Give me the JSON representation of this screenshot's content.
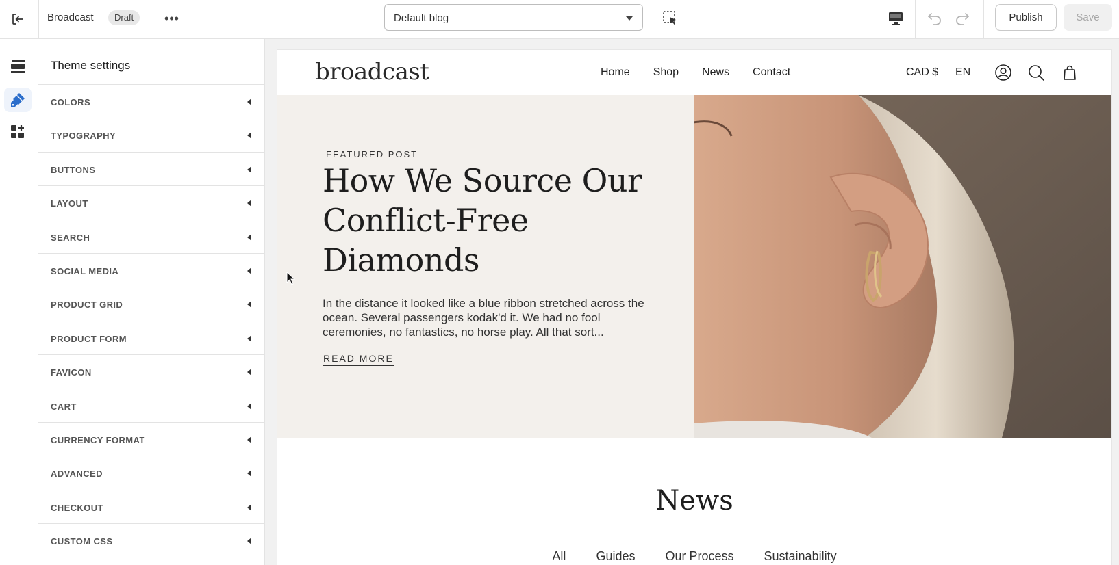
{
  "topbar": {
    "store_name": "Broadcast",
    "status_badge": "Draft",
    "more_label": "•••",
    "template_select": "Default blog",
    "publish_label": "Publish",
    "save_label": "Save"
  },
  "rail": {
    "items": [
      {
        "icon": "sections-icon"
      },
      {
        "icon": "theme-settings-brush-icon",
        "active": true
      },
      {
        "icon": "app-blocks-icon"
      }
    ]
  },
  "panel": {
    "title": "Theme settings",
    "items": [
      {
        "label": "COLORS"
      },
      {
        "label": "TYPOGRAPHY"
      },
      {
        "label": "BUTTONS"
      },
      {
        "label": "LAYOUT"
      },
      {
        "label": "SEARCH"
      },
      {
        "label": "SOCIAL MEDIA"
      },
      {
        "label": "PRODUCT GRID"
      },
      {
        "label": "PRODUCT FORM"
      },
      {
        "label": "FAVICON"
      },
      {
        "label": "CART"
      },
      {
        "label": "CURRENCY FORMAT"
      },
      {
        "label": "ADVANCED"
      },
      {
        "label": "CHECKOUT"
      },
      {
        "label": "CUSTOM CSS"
      }
    ]
  },
  "site": {
    "logo": "broadcast",
    "nav": [
      "Home",
      "Shop",
      "News",
      "Contact"
    ],
    "currency": "CAD $",
    "language": "EN",
    "hero": {
      "eyebrow": "FEATURED POST",
      "title": "How We Source Our Conflict-Free Diamonds",
      "body": "In the distance it looked like a blue ribbon stretched across the ocean. Several passengers kodak'd it. We had no fool ceremonies, no fantastics, no horse play. All that sort...",
      "cta": "READ MORE"
    },
    "news": {
      "title": "News",
      "tabs": [
        "All",
        "Guides",
        "Our Process",
        "Sustainability"
      ],
      "active_tab": "All"
    }
  },
  "colors": {
    "accent": "#2c6ecb",
    "hero_bg": "#f3f0ec"
  }
}
